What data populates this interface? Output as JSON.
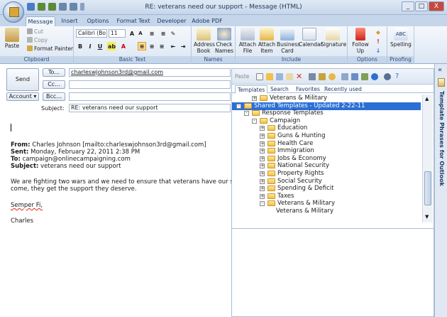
{
  "window": {
    "title": "RE: veterans need our support - Message (HTML)",
    "controls": [
      "_",
      "□",
      "X"
    ]
  },
  "tabs": [
    "Message",
    "Insert",
    "Options",
    "Format Text",
    "Developer",
    "Adobe PDF"
  ],
  "ribbon": {
    "clipboard": {
      "label": "Clipboard",
      "paste": "Paste",
      "cut": "Cut",
      "copy": "Copy",
      "format_painter": "Format Painter"
    },
    "basic_text": {
      "label": "Basic Text",
      "font": "Calibri (Bo",
      "size": "11",
      "bold": "B",
      "italic": "I",
      "underline": "U"
    },
    "names": {
      "label": "Names",
      "address_book": "Address Book",
      "check_names": "Check Names"
    },
    "include": {
      "label": "Include",
      "attach_file": "Attach File",
      "attach_item": "Attach Item",
      "business_card": "Business Card",
      "calendar": "Calendar",
      "signature": "Signature"
    },
    "options": {
      "label": "Options",
      "follow_up": "Follow Up"
    },
    "proofing": {
      "label": "Proofing",
      "spelling": "Spelling"
    }
  },
  "header": {
    "send": "Send",
    "account": "Account",
    "to_label": "To...",
    "cc_label": "Cc...",
    "bcc_label": "Bcc...",
    "to_value": "charleswjohnson3rd@gmail.com",
    "subject_label": "Subject:",
    "subject_value": "RE: veterans need our support"
  },
  "body": {
    "from_label": "From:",
    "from_value": "Charles Johnson [mailto:charleswjohnson3rd@gmail.com]",
    "sent_label": "Sent:",
    "sent_value": "Monday, February 22, 2011 2:38 PM",
    "to_label": "To:",
    "to_value": "campaign@onlinecampaigning.com",
    "subject_label": "Subject:",
    "subject_value": "veterans need our support",
    "line1": "We are fighting two wars and we need to ensure that veterans have our support",
    "line2": "come, they get the support they deserve.",
    "signoff": "Semper Fi,",
    "name": "Charles"
  },
  "panel": {
    "toolbar_paste": "Paste",
    "tabs": [
      "Templates",
      "Search",
      "Favorites",
      "Recently used"
    ],
    "tree": [
      {
        "label": "Veterans & Military",
        "level": 2,
        "expander": "+",
        "folder": true,
        "selected": false
      },
      {
        "label": "Shared Templates - Updated 2-22-11",
        "level": 0,
        "expander": "-",
        "folder": true,
        "selected": true
      },
      {
        "label": "Response Templates",
        "level": 1,
        "expander": "-",
        "folder": true,
        "selected": false
      },
      {
        "label": "Campaign",
        "level": 2,
        "expander": "-",
        "folder": true,
        "selected": false
      },
      {
        "label": "Education",
        "level": 3,
        "expander": "+",
        "folder": true,
        "selected": false
      },
      {
        "label": "Guns & Hunting",
        "level": 3,
        "expander": "+",
        "folder": true,
        "selected": false
      },
      {
        "label": "Health Care",
        "level": 3,
        "expander": "+",
        "folder": true,
        "selected": false
      },
      {
        "label": "Immigration",
        "level": 3,
        "expander": "+",
        "folder": true,
        "selected": false
      },
      {
        "label": "Jobs & Economy",
        "level": 3,
        "expander": "+",
        "folder": true,
        "selected": false
      },
      {
        "label": "National Security",
        "level": 3,
        "expander": "+",
        "folder": true,
        "selected": false
      },
      {
        "label": "Property Rights",
        "level": 3,
        "expander": "+",
        "folder": true,
        "selected": false
      },
      {
        "label": "Social Security",
        "level": 3,
        "expander": "+",
        "folder": true,
        "selected": false
      },
      {
        "label": "Spending & Deficit",
        "level": 3,
        "expander": "+",
        "folder": true,
        "selected": false
      },
      {
        "label": "Taxes",
        "level": 3,
        "expander": "+",
        "folder": true,
        "selected": false
      },
      {
        "label": "Veterans & Military",
        "level": 3,
        "expander": "-",
        "folder": true,
        "selected": false
      },
      {
        "label": "Veterans & Military",
        "level": 4,
        "expander": "",
        "folder": false,
        "selected": false
      }
    ]
  },
  "sidebar": {
    "label": "Template Phrases for Outlook",
    "collapse": "«"
  },
  "colors": {
    "accent": "#2b6fd6",
    "ribbon": "#dbe6f3",
    "folder": "#f3c04a"
  }
}
